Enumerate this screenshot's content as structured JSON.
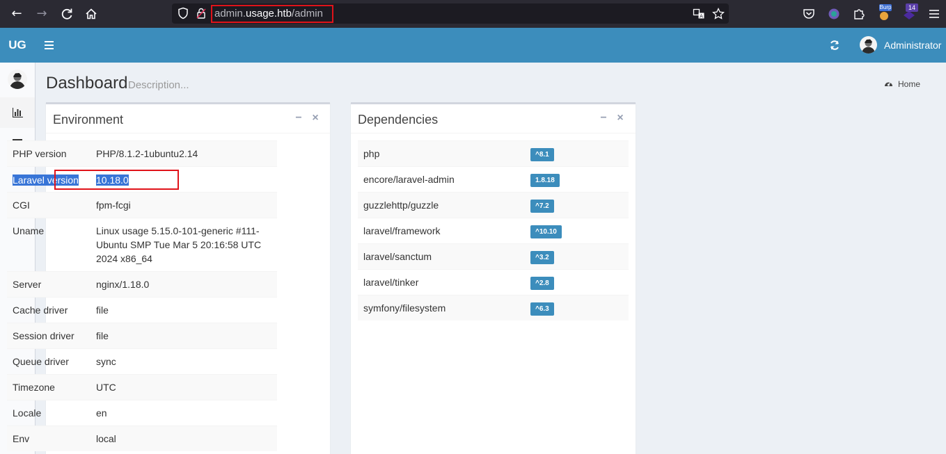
{
  "browser": {
    "url_prefix": "admin.",
    "url_host": "usage.htb",
    "url_path": "/admin",
    "extension_badge_label": "Burp",
    "extension_badge_count": "14"
  },
  "header": {
    "logo": "UG",
    "user_name": "Administrator",
    "bar_color": "#3c8dbc"
  },
  "content": {
    "title": "Dashboard",
    "description": "Description...",
    "breadcrumb_home": "Home"
  },
  "environment": {
    "title": "Environment",
    "rows": [
      {
        "key": "PHP version",
        "value": "PHP/8.1.2-1ubuntu2.14"
      },
      {
        "key": "Laravel version",
        "value": "10.18.0"
      },
      {
        "key": "CGI",
        "value": "fpm-fcgi"
      },
      {
        "key": "Uname",
        "value": "Linux usage 5.15.0-101-generic #111-Ubuntu SMP Tue Mar 5 20:16:58 UTC 2024 x86_64"
      },
      {
        "key": "Server",
        "value": "nginx/1.18.0"
      },
      {
        "key": "Cache driver",
        "value": "file"
      },
      {
        "key": "Session driver",
        "value": "file"
      },
      {
        "key": "Queue driver",
        "value": "sync"
      },
      {
        "key": "Timezone",
        "value": "UTC"
      },
      {
        "key": "Locale",
        "value": "en"
      },
      {
        "key": "Env",
        "value": "local"
      }
    ]
  },
  "dependencies": {
    "title": "Dependencies",
    "rows": [
      {
        "name": "php",
        "version": "^8.1"
      },
      {
        "name": "encore/laravel-admin",
        "version": "1.8.18"
      },
      {
        "name": "guzzlehttp/guzzle",
        "version": "^7.2"
      },
      {
        "name": "laravel/framework",
        "version": "^10.10"
      },
      {
        "name": "laravel/sanctum",
        "version": "^3.2"
      },
      {
        "name": "laravel/tinker",
        "version": "^2.8"
      },
      {
        "name": "symfony/filesystem",
        "version": "^6.3"
      }
    ]
  },
  "icons": {
    "back": "arrow-left-icon",
    "forward": "arrow-right-icon",
    "reload": "reload-icon",
    "home": "home-icon",
    "menu": "hamburger-icon",
    "refresh": "refresh-icon",
    "dashboard": "bar-chart-icon",
    "list": "list-icon"
  }
}
